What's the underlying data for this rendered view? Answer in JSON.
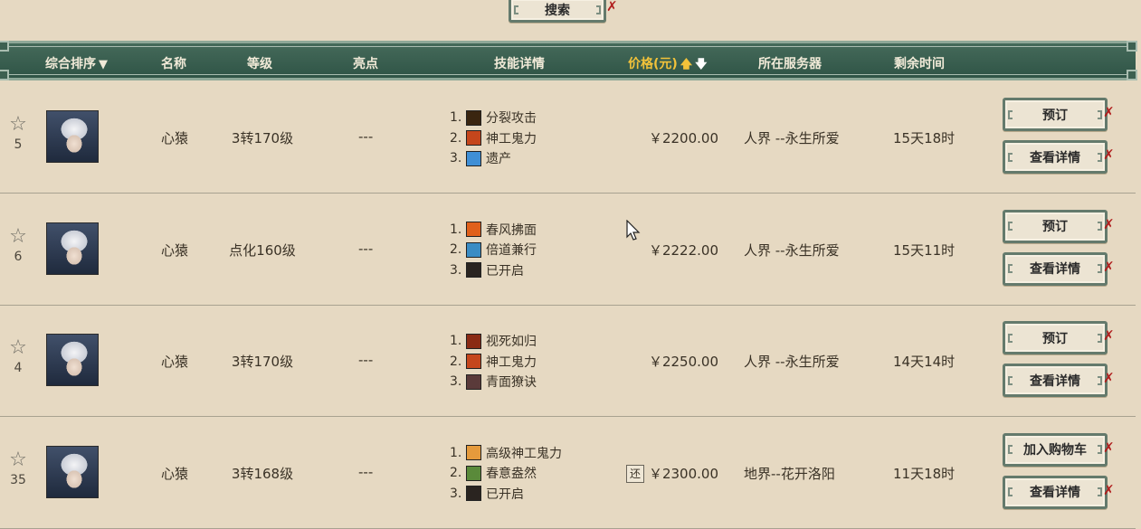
{
  "search": {
    "label": "搜索"
  },
  "header": {
    "columns": {
      "sort": "综合排序",
      "name": "名称",
      "level": "等级",
      "highlight": "亮点",
      "skills": "技能详情",
      "price": "价格(元)",
      "server": "所在服务器",
      "time": "剩余时间"
    }
  },
  "rows": [
    {
      "favorites": "5",
      "name": "心猿",
      "level": "3转170级",
      "highlight": "---",
      "skills": [
        {
          "idx": "1.",
          "name": "分裂攻击",
          "icon": "split-attack-icon",
          "color": "#3a2510"
        },
        {
          "idx": "2.",
          "name": "神工鬼力",
          "icon": "divine-power-icon",
          "color": "#c5461c"
        },
        {
          "idx": "3.",
          "name": "遗产",
          "icon": "legacy-icon",
          "color": "#3f8fd6"
        }
      ],
      "refund": "",
      "price": "￥2200.00",
      "server": "人界 --永生所爱",
      "time": "15天18时",
      "action_primary": "预订",
      "action_secondary": "查看详情"
    },
    {
      "favorites": "6",
      "name": "心猿",
      "level": "点化160级",
      "highlight": "---",
      "skills": [
        {
          "idx": "1.",
          "name": "春风拂面",
          "icon": "spring-breeze-icon",
          "color": "#e0601a"
        },
        {
          "idx": "2.",
          "name": "倍道兼行",
          "icon": "double-march-icon",
          "color": "#3a8cc4"
        },
        {
          "idx": "3.",
          "name": "已开启",
          "icon": "unlocked-slot-icon",
          "color": "#2a2420"
        }
      ],
      "refund": "",
      "price": "￥2222.00",
      "server": "人界 --永生所爱",
      "time": "15天11时",
      "action_primary": "预订",
      "action_secondary": "查看详情"
    },
    {
      "favorites": "4",
      "name": "心猿",
      "level": "3转170级",
      "highlight": "---",
      "skills": [
        {
          "idx": "1.",
          "name": "视死如归",
          "icon": "fearless-icon",
          "color": "#8a2a14"
        },
        {
          "idx": "2.",
          "name": "神工鬼力",
          "icon": "divine-power-icon",
          "color": "#c5461c"
        },
        {
          "idx": "3.",
          "name": "青面獠诀",
          "icon": "blue-face-icon",
          "color": "#5a3a3a"
        }
      ],
      "refund": "",
      "price": "￥2250.00",
      "server": "人界 --永生所爱",
      "time": "14天14时",
      "action_primary": "预订",
      "action_secondary": "查看详情"
    },
    {
      "favorites": "35",
      "name": "心猿",
      "level": "3转168级",
      "highlight": "---",
      "skills": [
        {
          "idx": "1.",
          "name": "高级神工鬼力",
          "icon": "adv-divine-power-icon",
          "color": "#e59a3c"
        },
        {
          "idx": "2.",
          "name": "春意盎然",
          "icon": "spring-vitality-icon",
          "color": "#5a8a3a"
        },
        {
          "idx": "3.",
          "name": "已开启",
          "icon": "unlocked-slot-icon",
          "color": "#2a2420"
        }
      ],
      "refund": "还",
      "price": "￥2300.00",
      "server": "地界--花开洛阳",
      "time": "11天18时",
      "action_primary": "加入购物车",
      "action_secondary": "查看详情"
    }
  ]
}
